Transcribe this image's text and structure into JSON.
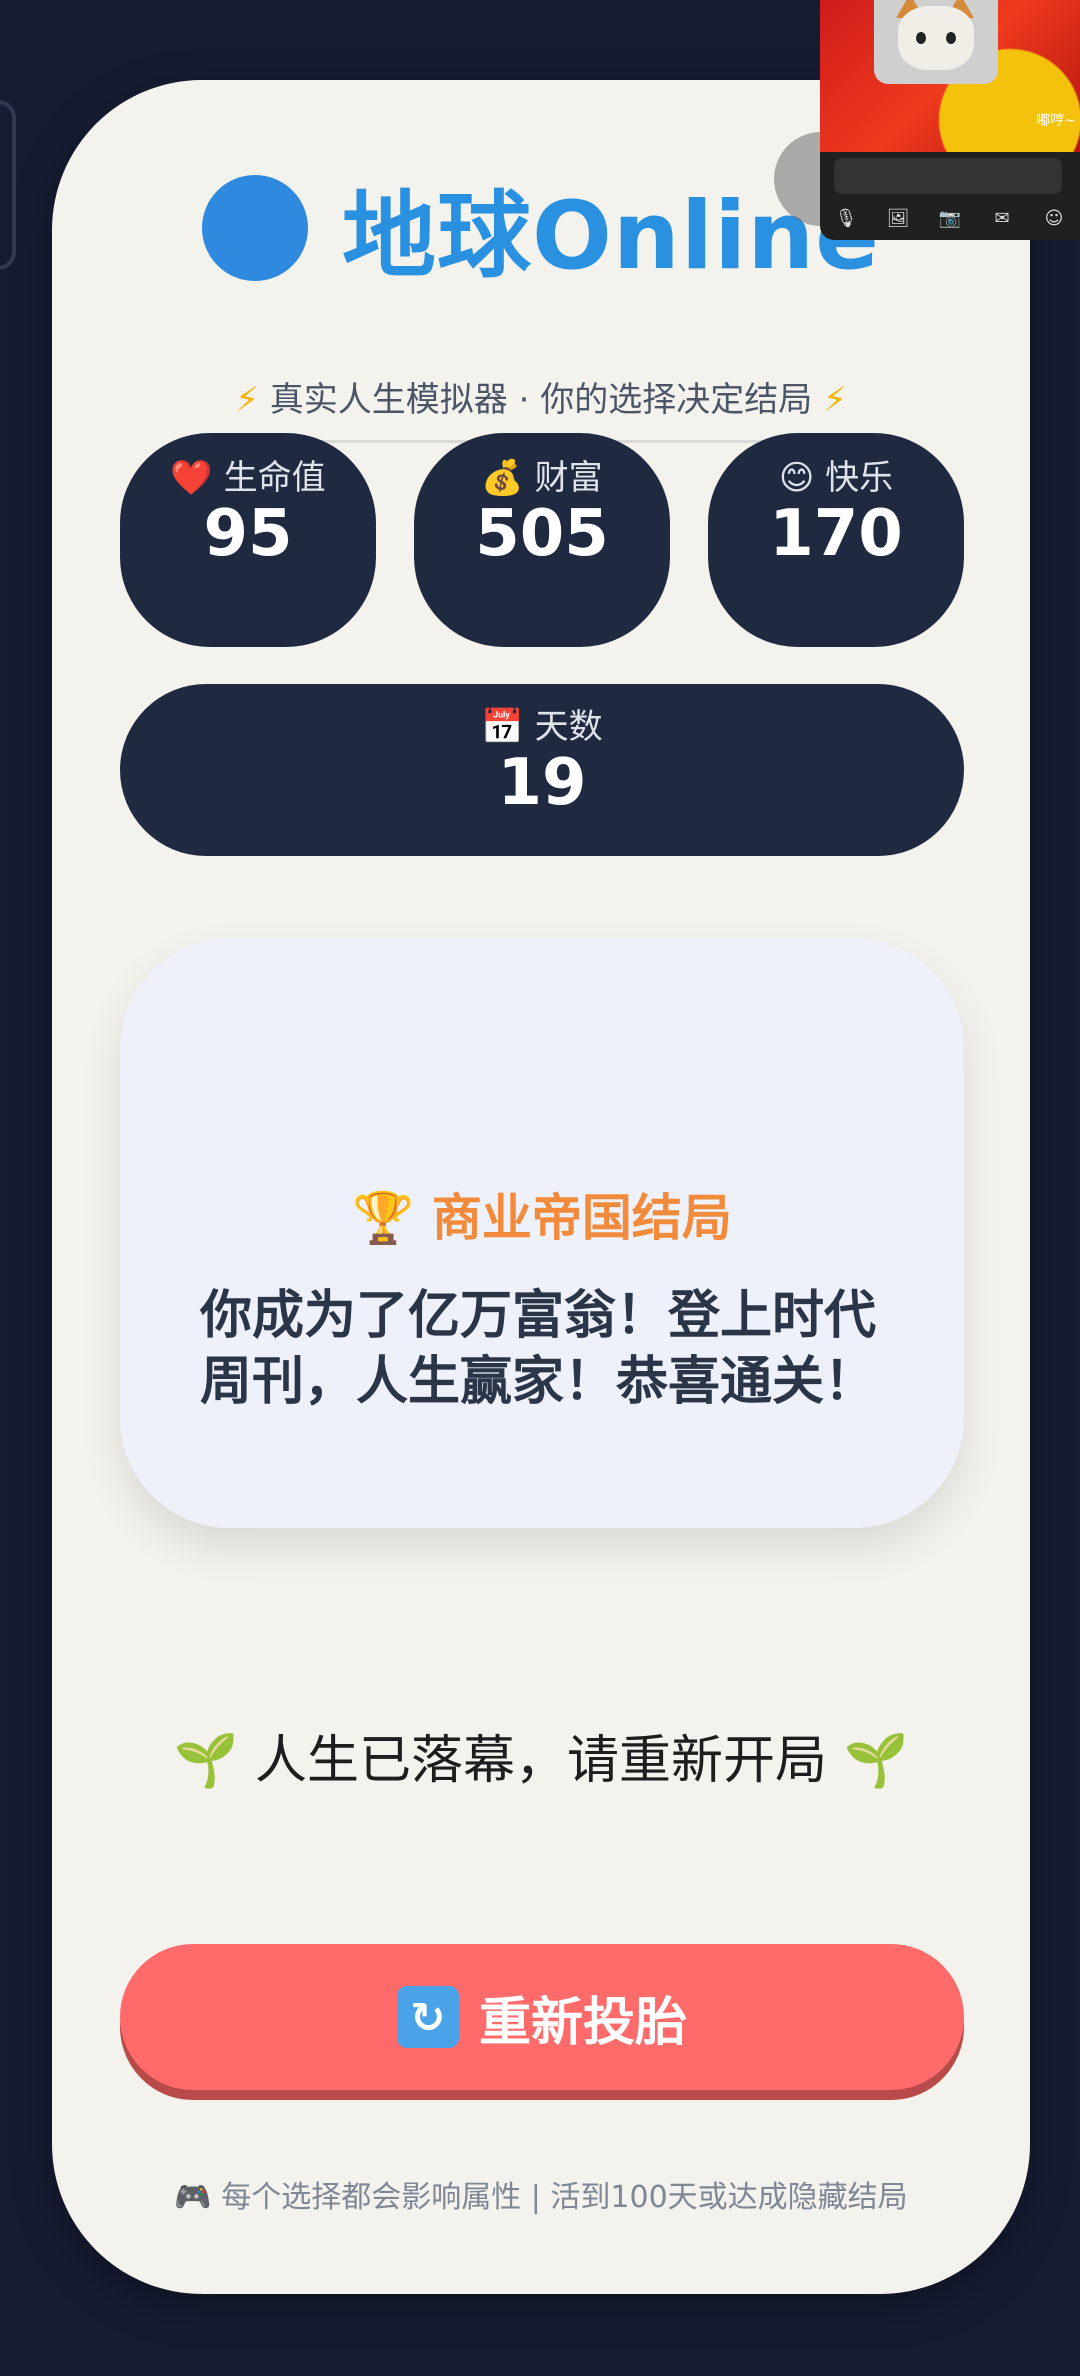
{
  "header": {
    "title": "地球Online",
    "subtitle": "真实人生模拟器 · 你的选择决定结局",
    "bolt_icon": "⚡"
  },
  "stats": {
    "health": {
      "icon": "❤️",
      "label": "生命值",
      "value": "95"
    },
    "wealth": {
      "icon": "💰",
      "label": "财富",
      "value": "505"
    },
    "happiness": {
      "icon": "😊",
      "label": "快乐",
      "value": "170"
    },
    "days": {
      "icon": "📅",
      "label": "天数",
      "value": "19"
    }
  },
  "ending": {
    "icon": "🏆",
    "title": "商业帝国结局",
    "text": "你成为了亿万富翁！登上时代周刊，人生赢家！恭喜通关！"
  },
  "restart_message": {
    "icon": "🌱",
    "text": "人生已落幕，请重新开局"
  },
  "restart_button": {
    "icon": "🔄",
    "label": "重新投胎"
  },
  "footer": {
    "icon": "🎮",
    "text": "每个选择都会影响属性 | 活到100天或达成隐藏结局"
  },
  "overlay": {
    "caption": "嘟哼~"
  },
  "colors": {
    "background": "#161d33",
    "card": "#f3f2ed",
    "stat_box": "#1f2a40",
    "title": "#2a90e0",
    "ending_title": "#f28a3c",
    "restart_button": "#ff6b6b"
  }
}
